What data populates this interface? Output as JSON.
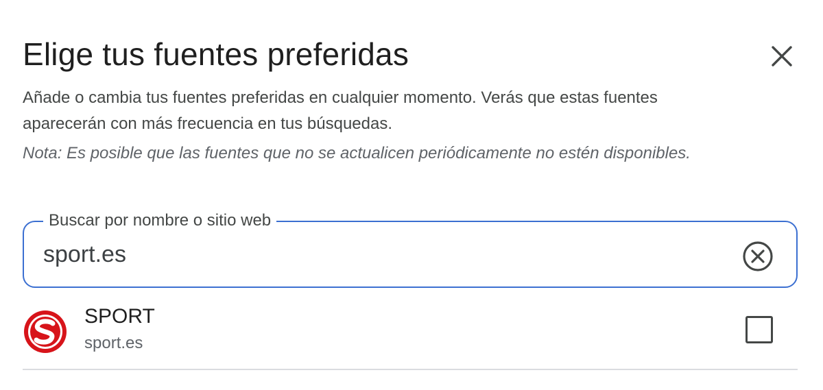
{
  "dialog": {
    "title": "Elige tus fuentes preferidas",
    "description": "Añade o cambia tus fuentes preferidas en cualquier momento. Verás que estas fuentes aparecerán con más frecuencia en tus búsquedas.",
    "note": "Nota: Es posible que las fuentes que no se actualicen periódicamente no estén disponibles."
  },
  "search": {
    "label": "Buscar por nombre o sitio web",
    "value": "sport.es"
  },
  "results": [
    {
      "name": "SPORT",
      "site": "sport.es",
      "checked": false,
      "logo_color": "#d7141a"
    }
  ],
  "icons": {
    "close": "close-icon",
    "clear": "clear-circle-icon",
    "logo": "sport-logo-icon"
  },
  "colors": {
    "accent": "#3b6fd1",
    "text": "#1f1f1f",
    "muted": "#5f6368"
  }
}
